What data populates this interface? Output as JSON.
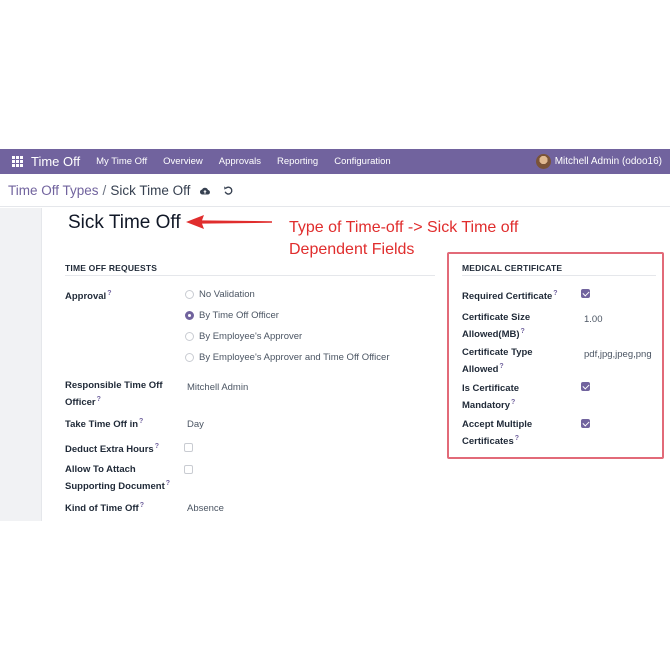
{
  "topnav": {
    "app_icon": "apps-grid-icon",
    "app_name": "Time Off",
    "menu": [
      "My Time Off",
      "Overview",
      "Approvals",
      "Reporting",
      "Configuration"
    ],
    "user": "Mitchell Admin (odoo16)"
  },
  "breadcrumb": {
    "parent": "Time Off Types",
    "separator": "/",
    "current": "Sick Time Off",
    "save_icon": "cloud-upload-icon",
    "discard_icon": "undo-icon"
  },
  "record": {
    "title": "Sick Time Off"
  },
  "annotation": {
    "line1": "Type of Time-off -> Sick Time off",
    "line2": "Dependent Fields",
    "color": "#e02d2d"
  },
  "requests": {
    "section_title": "TIME OFF REQUESTS",
    "approval_label": "Approval",
    "approval_options": [
      {
        "label": "No Validation",
        "selected": false
      },
      {
        "label": "By Time Off Officer",
        "selected": true
      },
      {
        "label": "By Employee's Approver",
        "selected": false
      },
      {
        "label": "By Employee's Approver and Time Off Officer",
        "selected": false
      }
    ],
    "officer_label_1": "Responsible Time Off",
    "officer_label_2": "Officer",
    "officer_value": "Mitchell Admin",
    "take_in_label": "Take Time Off in",
    "take_in_value": "Day",
    "deduct_label": "Deduct Extra Hours",
    "deduct_checked": false,
    "attach_label_1": "Allow To Attach",
    "attach_label_2": "Supporting Document",
    "attach_checked": false,
    "kind_label": "Kind of Time Off",
    "kind_value": "Absence"
  },
  "medical": {
    "section_title": "MEDICAL CERTIFICATE",
    "required_label": "Required Certificate",
    "required_checked": true,
    "size_label_1": "Certificate Size",
    "size_label_2": "Allowed(MB)",
    "size_value": "1.00",
    "type_label_1": "Certificate Type",
    "type_label_2": "Allowed",
    "type_value": "pdf,jpg,jpeg,png",
    "mandatory_label_1": "Is Certificate",
    "mandatory_label_2": "Mandatory",
    "mandatory_checked": true,
    "multiple_label_1": "Accept Multiple",
    "multiple_label_2": "Certificates",
    "multiple_checked": true,
    "highlight_color": "#e26a78"
  },
  "help_mark": "?",
  "colors": {
    "brand": "#71639e"
  }
}
